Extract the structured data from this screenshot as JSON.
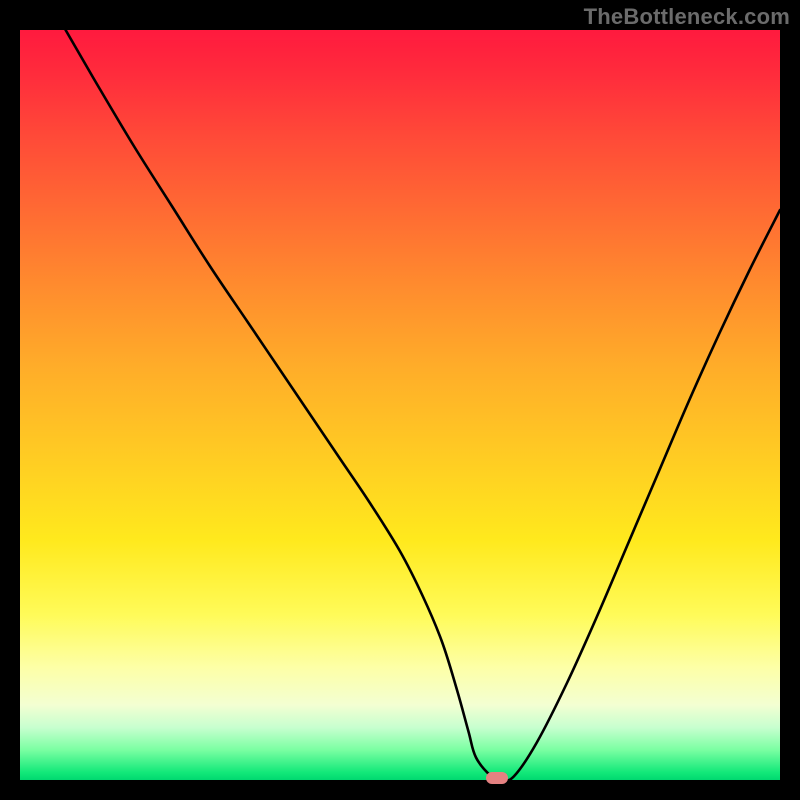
{
  "watermark": "TheBottleneck.com",
  "chart_data": {
    "type": "line",
    "title": "",
    "xlabel": "",
    "ylabel": "",
    "xlim": [
      0,
      100
    ],
    "ylim": [
      0,
      100
    ],
    "series": [
      {
        "name": "curve",
        "x": [
          6,
          10,
          15,
          20,
          25,
          30,
          34,
          38,
          42,
          46,
          50,
          53,
          55.5,
          57.5,
          59,
          60,
          62,
          63.3,
          65,
          68,
          72,
          76,
          80,
          84,
          88,
          92,
          96,
          100
        ],
        "values": [
          100,
          93,
          84.5,
          76.5,
          68.5,
          61,
          55,
          49,
          43,
          37,
          30.5,
          24.5,
          18.5,
          12,
          6.5,
          3,
          0.5,
          0,
          0.5,
          5,
          13,
          22,
          31.5,
          41,
          50.5,
          59.5,
          68,
          76
        ]
      }
    ],
    "marker": {
      "x": 62.7,
      "y": 0.3
    },
    "colors": {
      "curve": "#000000",
      "marker": "#e48181",
      "gradient_top": "#ff1a3e",
      "gradient_bottom": "#00d870",
      "frame": "#000000"
    }
  }
}
